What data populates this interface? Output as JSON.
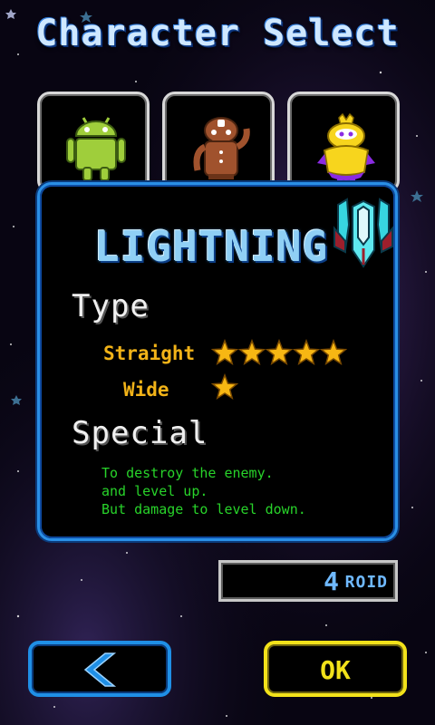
{
  "screen": {
    "title": "Character Select"
  },
  "characters": [
    {
      "icon": "android-robot-icon",
      "color": "#9fce3b"
    },
    {
      "icon": "gingerbread-robot-icon",
      "color": "#a0522d"
    },
    {
      "icon": "yellow-bird-robot-icon",
      "color": "#f7d51d"
    }
  ],
  "selected": {
    "name": "LIGHTNING",
    "icon": "lightning-ship-icon",
    "type_label": "Type",
    "stats": [
      {
        "label": "Straight",
        "stars": 5
      },
      {
        "label": "Wide",
        "stars": 1
      }
    ],
    "special_label": "Special",
    "special_lines": [
      "To destroy the enemy.",
      "and level up.",
      "But damage to level down."
    ]
  },
  "currency": {
    "amount": "4",
    "unit": "ROID"
  },
  "buttons": {
    "back_icon": "back-arrow-icon",
    "ok_label": "OK"
  },
  "colors": {
    "accent_blue": "#2a8fe6",
    "ok_yellow": "#f2e21a",
    "stat_gold": "#f2b318",
    "desc_green": "#28d32a"
  }
}
